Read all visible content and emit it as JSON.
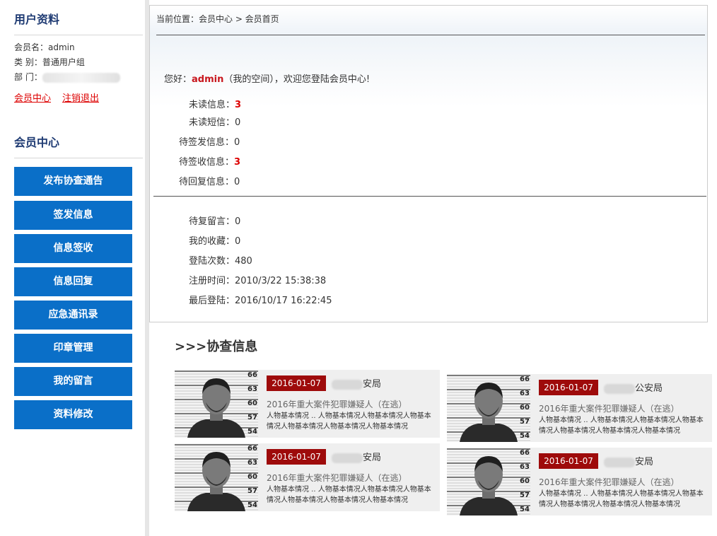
{
  "sidebar": {
    "profile_title": "用户资料",
    "member_name": "会员名：admin",
    "member_type": "类  别：普通用户组",
    "department": "部  门：",
    "links": {
      "member_center": "会员中心",
      "logout": "注销退出"
    },
    "center_title": "会员中心",
    "menu": [
      "发布协查通告",
      "签发信息",
      "信息签收",
      "信息回复",
      "应急通讯录",
      "印章管理",
      "我的留言",
      "资料修改"
    ]
  },
  "panel": {
    "breadcrumb": "当前位置：会员中心 > 会员首页",
    "welcome_prefix": "您好：",
    "username": "admin",
    "welcome_suffix": "（我的空间），欢迎您登陆会员中心!",
    "stats": [
      {
        "label": "未读信息：",
        "value": "3",
        "highlight": true
      },
      {
        "label": "未读短信：",
        "value": "0",
        "highlight": false
      },
      {
        "label": "待签发信息：",
        "value": "0",
        "highlight": false
      },
      {
        "label": "待签收信息：",
        "value": "3",
        "highlight": true
      },
      {
        "label": "待回复信息：",
        "value": "0",
        "highlight": false
      }
    ],
    "account": [
      {
        "label": "待复留言：",
        "value": "0"
      },
      {
        "label": "我的收藏：",
        "value": "0"
      },
      {
        "label": "登陆次数：",
        "value": "480"
      },
      {
        "label": "注册时间：",
        "value": "2010/3/22 15:38:38"
      },
      {
        "label": "最后登陆：",
        "value": "2016/10/17 16:22:45"
      }
    ]
  },
  "assist": {
    "section_title": ">>>协查信息",
    "cards": [
      {
        "date": "2016-01-07",
        "org": "安局",
        "title": "2016年重大案件犯罪嫌疑人（在逃）",
        "desc": "人物基本情况 .. 人物基本情况人物基本情况人物基本情况人物基本情况人物基本情况人物基本情况"
      },
      {
        "date": "2016-01-07",
        "org": "公安局",
        "title": "2016年重大案件犯罪嫌疑人（在逃）",
        "desc": "人物基本情况 .. 人物基本情况人物基本情况人物基本情况人物基本情况人物基本情况人物基本情况"
      },
      {
        "date": "2016-01-07",
        "org": "安局",
        "title": "2016年重大案件犯罪嫌疑人（在逃）",
        "desc": "人物基本情况 .. 人物基本情况人物基本情况人物基本情况人物基本情况人物基本情况人物基本情况"
      },
      {
        "date": "2016-01-07",
        "org": "安局",
        "title": "2016年重大案件犯罪嫌疑人（在逃）",
        "desc": "人物基本情况 .. 人物基本情况人物基本情况人物基本情况人物基本情况人物基本情况人物基本情况"
      }
    ],
    "height_scale": [
      "66",
      "63",
      "60",
      "57",
      "54"
    ]
  },
  "colors": {
    "menu_blue": "#0a6fc8",
    "title_navy": "#1f3b73",
    "date_red": "#9e0b0b",
    "alert_red": "#dd0000"
  }
}
